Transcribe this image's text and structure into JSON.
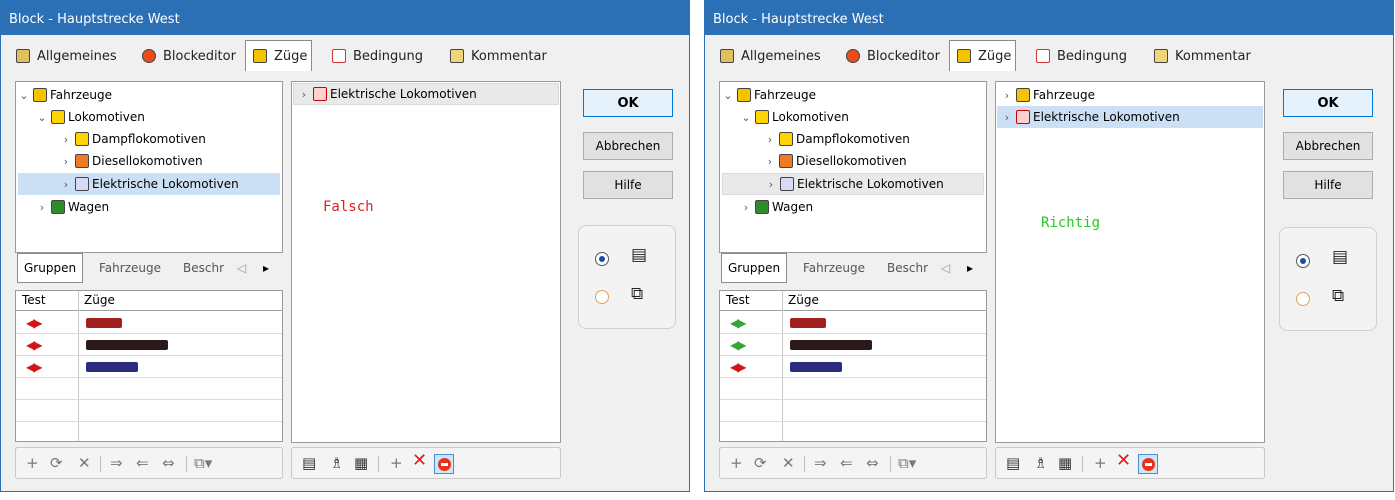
{
  "dialogs": [
    {
      "title": "Block - Hauptstrecke West",
      "tabs": [
        "Allgemeines",
        "Blockeditor",
        "Züge",
        "Bedingung",
        "Kommentar"
      ],
      "active_tab": "Züge",
      "tree": [
        "Fahrzeuge",
        "Lokomotiven",
        "Dampflokomotiven",
        "Diesellokomotiven",
        "Elektrische Lokomotiven",
        "Wagen"
      ],
      "selected_tree_item": "Elektrische Lokomotiven",
      "right_list": [
        "Elektrische Lokomotiven"
      ],
      "subtabs": [
        "Gruppen",
        "Fahrzeuge",
        "Beschr"
      ],
      "table_headers": [
        "Test",
        "Züge"
      ],
      "signals": [
        "red",
        "red",
        "red"
      ],
      "buttons": {
        "ok": "OK",
        "cancel": "Abbrechen",
        "help": "Hilfe"
      },
      "annotation": "Falsch"
    },
    {
      "title": "Block - Hauptstrecke West",
      "tabs": [
        "Allgemeines",
        "Blockeditor",
        "Züge",
        "Bedingung",
        "Kommentar"
      ],
      "active_tab": "Züge",
      "tree": [
        "Fahrzeuge",
        "Lokomotiven",
        "Dampflokomotiven",
        "Diesellokomotiven",
        "Elektrische Lokomotiven",
        "Wagen"
      ],
      "selected_tree_item": "Elektrische Lokomotiven",
      "right_list": [
        "Fahrzeuge",
        "Elektrische Lokomotiven"
      ],
      "subtabs": [
        "Gruppen",
        "Fahrzeuge",
        "Beschr"
      ],
      "table_headers": [
        "Test",
        "Züge"
      ],
      "signals": [
        "green",
        "green",
        "red"
      ],
      "buttons": {
        "ok": "OK",
        "cancel": "Abbrechen",
        "help": "Hilfe"
      },
      "annotation": "Richtig"
    }
  ],
  "colors": {
    "titlebar": "#2b6fb5",
    "falsch": "#e02020",
    "richtig": "#22cc22"
  },
  "icons": [
    "signal-red-icon",
    "signal-green-icon",
    "stop-icon",
    "add-icon",
    "delete-icon",
    "list-view-icon",
    "copy-icon"
  ]
}
